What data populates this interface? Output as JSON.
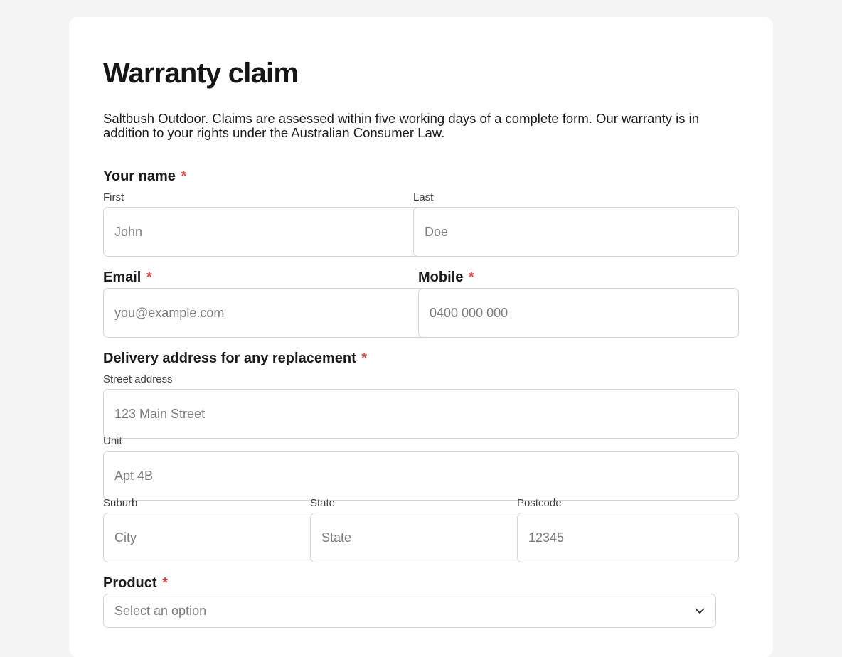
{
  "form": {
    "title": "Warranty claim",
    "description": "Saltbush Outdoor. Claims are assessed within five working days of a complete form. Our warranty is in addition to your rights under the Australian Consumer Law.",
    "required_marker": "*",
    "name": {
      "label": "Your name",
      "first_label": "First",
      "first_placeholder": "John",
      "last_label": "Last",
      "last_placeholder": "Doe"
    },
    "email": {
      "label": "Email",
      "placeholder": "you@example.com"
    },
    "mobile": {
      "label": "Mobile",
      "placeholder": "0400 000 000"
    },
    "address": {
      "label": "Delivery address for any replacement",
      "street_label": "Street address",
      "street_placeholder": "123 Main Street",
      "unit_label": "Unit",
      "unit_placeholder": "Apt 4B",
      "suburb_label": "Suburb",
      "suburb_placeholder": "City",
      "state_label": "State",
      "state_placeholder": "State",
      "postcode_label": "Postcode",
      "postcode_placeholder": "12345"
    },
    "product": {
      "label": "Product",
      "selected": "Select an option",
      "icon": "chevron-down-icon"
    }
  },
  "colors": {
    "page_bg": "#f4f4f4",
    "card_bg": "#ffffff",
    "required": "#e04545",
    "border": "#d4d4d4",
    "placeholder": "#7c7c7c"
  }
}
